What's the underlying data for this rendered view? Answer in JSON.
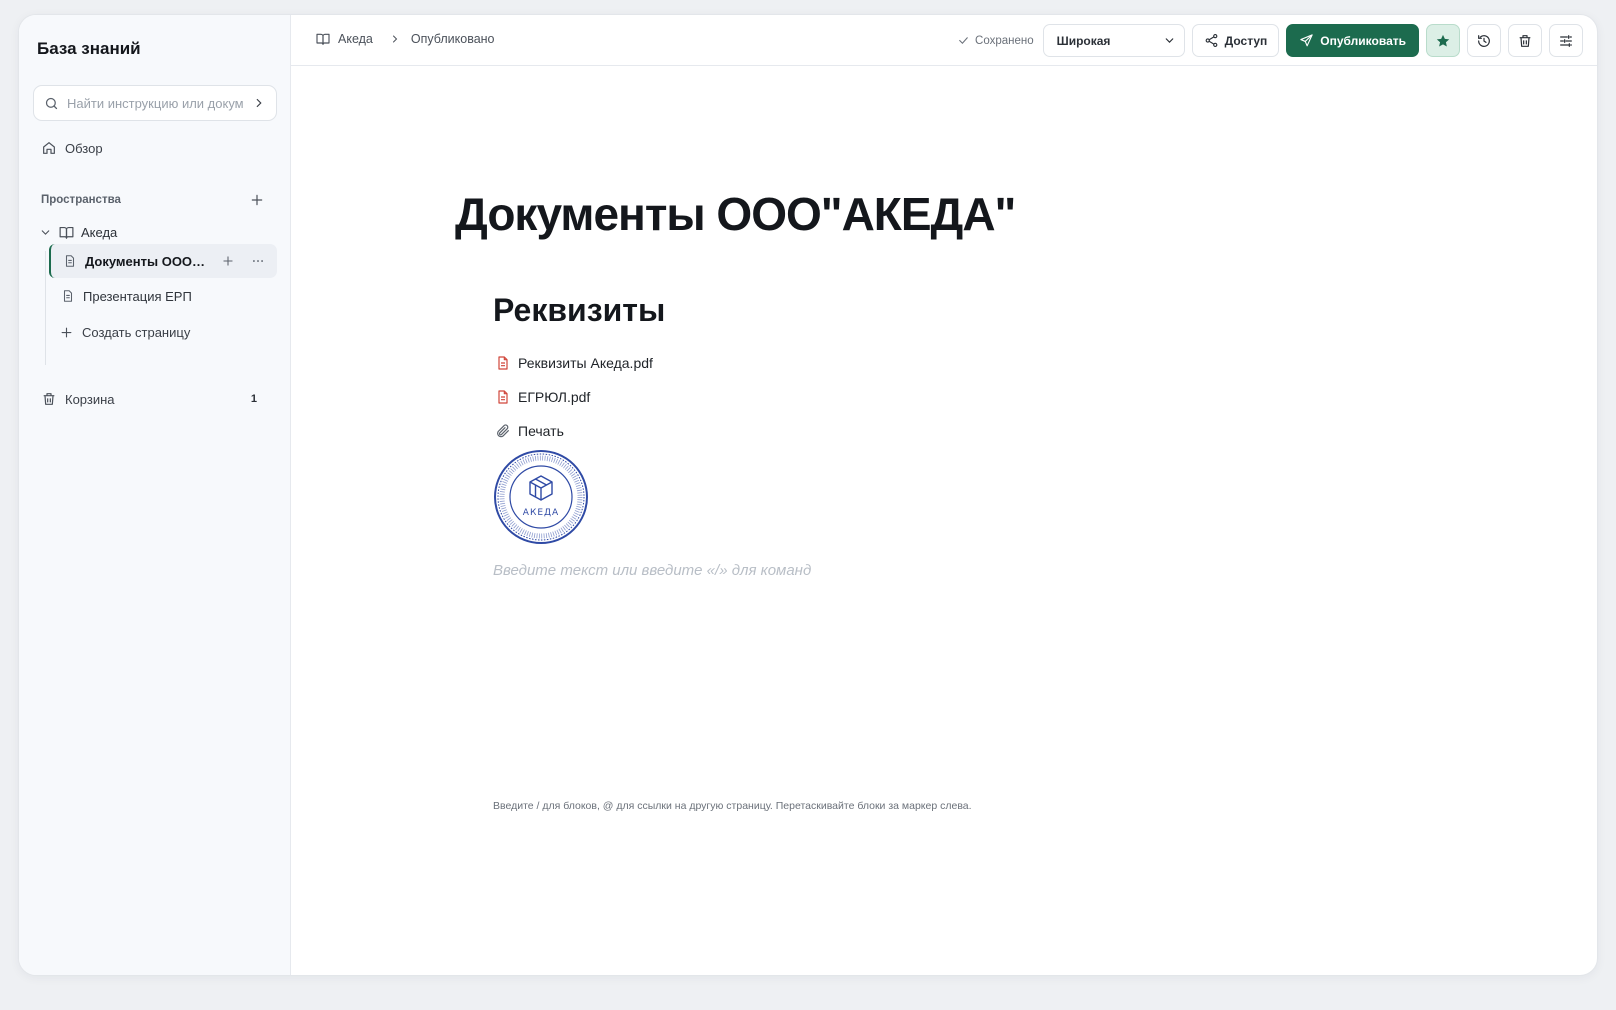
{
  "sidebar": {
    "title": "База знаний",
    "search_placeholder": "Найти инструкцию или документ",
    "overview_label": "Обзор",
    "spaces_label": "Пространства",
    "space": {
      "name": "Акеда"
    },
    "pages": [
      {
        "label": "Документы ООО\"АКЕДА\""
      },
      {
        "label": "Презентация ЕРП"
      }
    ],
    "create_page_label": "Создать страницу",
    "trash_label": "Корзина",
    "trash_count": "1"
  },
  "breadcrumb": {
    "space": "Акеда",
    "status": "Опубликовано"
  },
  "toolbar": {
    "saved_label": "Сохранено",
    "width_select": {
      "selected": "Широкая",
      "options": [
        "Широкая"
      ]
    },
    "access_label": "Доступ",
    "publish_label": "Опубликовать"
  },
  "document": {
    "title": "Документы ООО\"АКЕДА\"",
    "heading": "Реквизиты",
    "attachments": [
      {
        "name": "Реквизиты Акеда.pdf",
        "type": "pdf"
      },
      {
        "name": "ЕГРЮЛ.pdf",
        "type": "pdf"
      },
      {
        "name": "Печать",
        "type": "attachment"
      }
    ],
    "stamp_text": "АКЕДА",
    "editor_placeholder": "Введите текст или введите «/» для команд",
    "hint": "Введите / для блоков, @ для ссылки на другую страницу. Перетаскивайте блоки за маркер слева."
  },
  "colors": {
    "accent": "#1c6b4e",
    "pdf_icon": "#d0463b",
    "stamp": "#2f4aa5"
  },
  "icons": [
    "search-icon",
    "chevron-right-icon",
    "home-icon",
    "plus-icon",
    "chevron-down-icon",
    "book-icon",
    "page-icon",
    "more-icon",
    "trash-icon",
    "check-icon",
    "share-icon",
    "send-icon",
    "star-icon",
    "history-icon",
    "settings-sliders-icon",
    "pdf-file-icon",
    "paperclip-icon"
  ]
}
